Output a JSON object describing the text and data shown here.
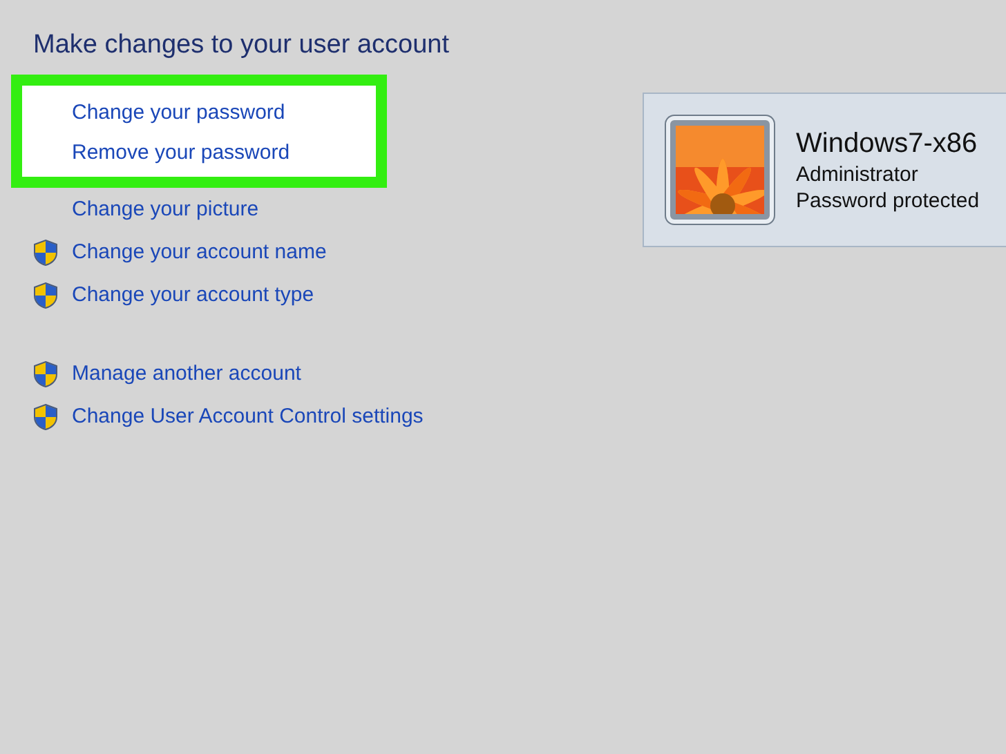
{
  "heading": "Make changes to your user account",
  "highlighted_links": [
    {
      "label": "Change your password",
      "shield": false
    },
    {
      "label": "Remove your password",
      "shield": false
    }
  ],
  "links": [
    {
      "label": "Change your picture",
      "shield": false
    },
    {
      "label": "Change your account name",
      "shield": true
    },
    {
      "label": "Change your account type",
      "shield": true
    }
  ],
  "other_links": [
    {
      "label": "Manage another account",
      "shield": true
    },
    {
      "label": "Change User Account Control settings",
      "shield": true
    }
  ],
  "account": {
    "kind": "picture",
    "name": "Windows7-x86",
    "role": "Administrator",
    "status": "Password protected"
  }
}
